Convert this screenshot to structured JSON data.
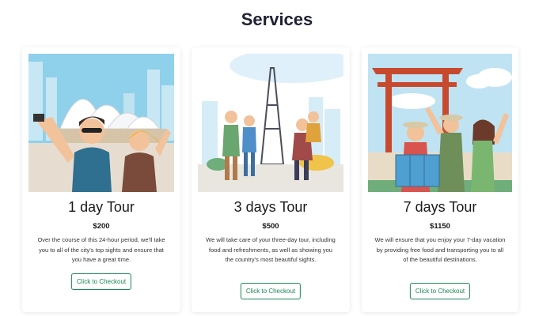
{
  "page": {
    "title": "Services"
  },
  "colors": {
    "button": "#198754",
    "title": "#1f2033"
  },
  "cards": [
    {
      "image": "sydney-opera-house-tourists",
      "title": "1 day Tour",
      "price": "$200",
      "description": "Over the course of this 24-hour period, we'll take you to all of the city's top sights and ensure that you have a great time.",
      "button": "Click to Checkout"
    },
    {
      "image": "eiffel-tower-tourists",
      "title": "3 days Tour",
      "price": "$500",
      "description": "We will take care of your three-day tour, including food and refreshments, as well as showing you the country's most beautiful sights.",
      "button": "Click to Checkout"
    },
    {
      "image": "japanese-torii-gate-tourists",
      "title": "7 days Tour",
      "price": "$1150",
      "description": "We will ensure that you enjoy your 7-day vacation by providing free food and transporting you to all of the beautiful destinations.",
      "button": "Click to Checkout"
    }
  ]
}
